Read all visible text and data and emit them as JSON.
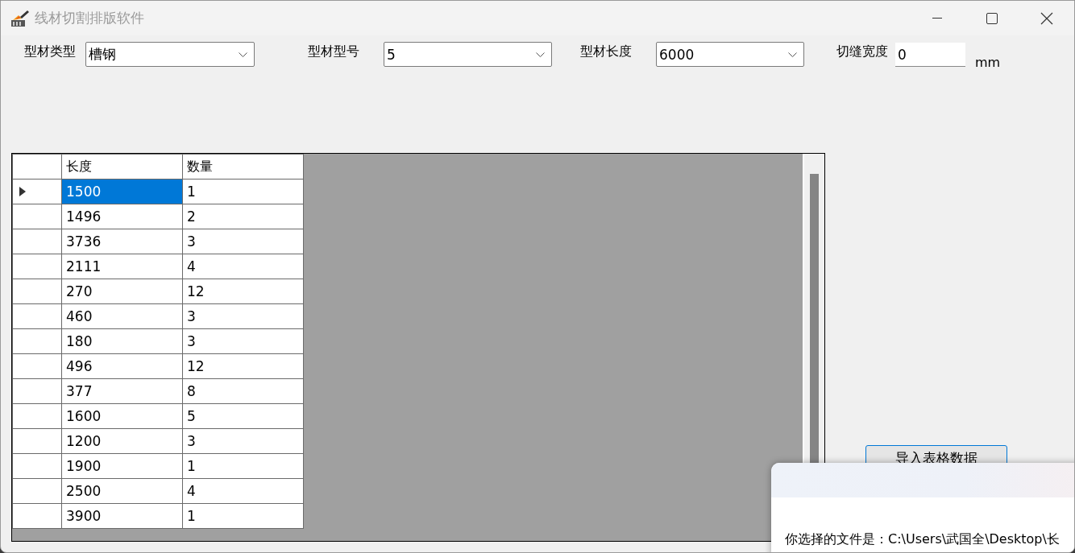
{
  "window": {
    "title": "线材切割排版软件"
  },
  "fields": [
    {
      "kind": "combo",
      "label": "型材类型",
      "value": "槽钢"
    },
    {
      "kind": "combo",
      "label": "型材型号",
      "value": "5"
    },
    {
      "kind": "combo",
      "label": "型材长度",
      "value": "6000"
    },
    {
      "kind": "text",
      "label": "切缝宽度",
      "value": "0",
      "unit": "mm"
    }
  ],
  "table": {
    "columns": [
      "长度",
      "数量"
    ],
    "rows": [
      {
        "current": true,
        "cells": [
          {
            "text": "1500",
            "selected": true
          },
          {
            "text": "1",
            "selected": false
          }
        ]
      },
      {
        "current": false,
        "cells": [
          {
            "text": "1496",
            "selected": false
          },
          {
            "text": "2",
            "selected": false
          }
        ]
      },
      {
        "current": false,
        "cells": [
          {
            "text": "3736",
            "selected": false
          },
          {
            "text": "3",
            "selected": false
          }
        ]
      },
      {
        "current": false,
        "cells": [
          {
            "text": "2111",
            "selected": false
          },
          {
            "text": "4",
            "selected": false
          }
        ]
      },
      {
        "current": false,
        "cells": [
          {
            "text": "270",
            "selected": false
          },
          {
            "text": "12",
            "selected": false
          }
        ]
      },
      {
        "current": false,
        "cells": [
          {
            "text": "460",
            "selected": false
          },
          {
            "text": "3",
            "selected": false
          }
        ]
      },
      {
        "current": false,
        "cells": [
          {
            "text": "180",
            "selected": false
          },
          {
            "text": "3",
            "selected": false
          }
        ]
      },
      {
        "current": false,
        "cells": [
          {
            "text": "496",
            "selected": false
          },
          {
            "text": "12",
            "selected": false
          }
        ]
      },
      {
        "current": false,
        "cells": [
          {
            "text": "377",
            "selected": false
          },
          {
            "text": "8",
            "selected": false
          }
        ]
      },
      {
        "current": false,
        "cells": [
          {
            "text": "1600",
            "selected": false
          },
          {
            "text": "5",
            "selected": false
          }
        ]
      },
      {
        "current": false,
        "cells": [
          {
            "text": "1200",
            "selected": false
          },
          {
            "text": "3",
            "selected": false
          }
        ]
      },
      {
        "current": false,
        "cells": [
          {
            "text": "1900",
            "selected": false
          },
          {
            "text": "1",
            "selected": false
          }
        ]
      },
      {
        "current": false,
        "cells": [
          {
            "text": "2500",
            "selected": false
          },
          {
            "text": "4",
            "selected": false
          }
        ]
      },
      {
        "current": false,
        "cells": [
          {
            "text": "3900",
            "selected": false
          },
          {
            "text": "1",
            "selected": false
          }
        ]
      }
    ]
  },
  "import_button": {
    "label": "导入表格数据"
  },
  "dialog": {
    "message": "你选择的文件是：C:\\Users\\武国全\\Desktop\\长"
  }
}
